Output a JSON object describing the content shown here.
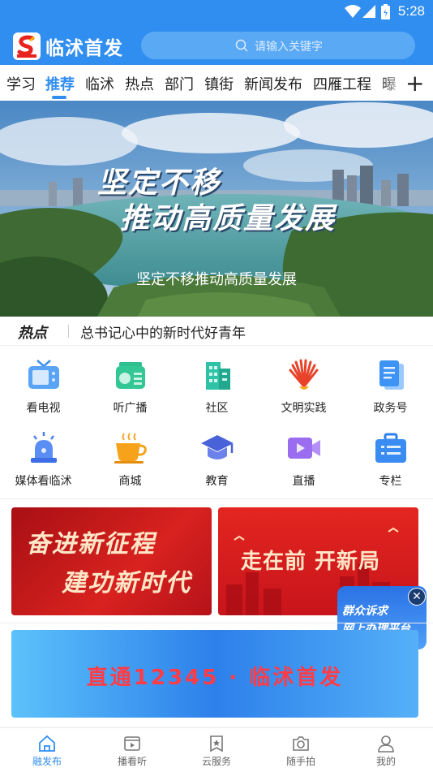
{
  "status_bar": {
    "time": "5:28"
  },
  "header": {
    "app_title": "临沭首发",
    "search_placeholder": "请输入关键字"
  },
  "tabs": [
    {
      "label": "学习"
    },
    {
      "label": "推荐"
    },
    {
      "label": "临沭"
    },
    {
      "label": "热点"
    },
    {
      "label": "部门"
    },
    {
      "label": "镇街"
    },
    {
      "label": "新闻发布"
    },
    {
      "label": "四雁工程"
    },
    {
      "label": "曝"
    }
  ],
  "active_tab": "推荐",
  "banner": {
    "headline_line1": "坚定不移",
    "headline_line2": "推动高质量发展",
    "caption": "坚定不移推动高质量发展"
  },
  "hot": {
    "label": "热点",
    "text": "总书记心中的新时代好青年"
  },
  "services": [
    {
      "label": "看电视",
      "icon": "tv-icon"
    },
    {
      "label": "听广播",
      "icon": "radio-icon"
    },
    {
      "label": "社区",
      "icon": "building-icon"
    },
    {
      "label": "文明实践",
      "icon": "civilization-icon"
    },
    {
      "label": "政务号",
      "icon": "document-icon"
    },
    {
      "label": "媒体看临沭",
      "icon": "alarm-light-icon"
    },
    {
      "label": "商城",
      "icon": "coffee-cup-icon"
    },
    {
      "label": "教育",
      "icon": "graduation-cap-icon"
    },
    {
      "label": "直播",
      "icon": "video-camera-icon"
    },
    {
      "label": "专栏",
      "icon": "briefcase-icon"
    }
  ],
  "promos": {
    "left_line1": "奋进新征程",
    "left_line2": "建功新时代",
    "right": "走在前 开新局"
  },
  "float_card": {
    "line1": "群众诉求",
    "line2": "网上办理平台"
  },
  "hotline": {
    "text": "直通12345 · 临沭首发"
  },
  "bottom_nav": [
    {
      "label": "融发布",
      "icon": "home-icon"
    },
    {
      "label": "播看听",
      "icon": "play-icon"
    },
    {
      "label": "云服务",
      "icon": "star-bookmark-icon"
    },
    {
      "label": "随手拍",
      "icon": "camera-icon"
    },
    {
      "label": "我的",
      "icon": "user-icon"
    }
  ],
  "colors": {
    "brand": "#2f8ef0",
    "promo_red": "#c8141c",
    "hotline_text": "#ff3c46"
  }
}
